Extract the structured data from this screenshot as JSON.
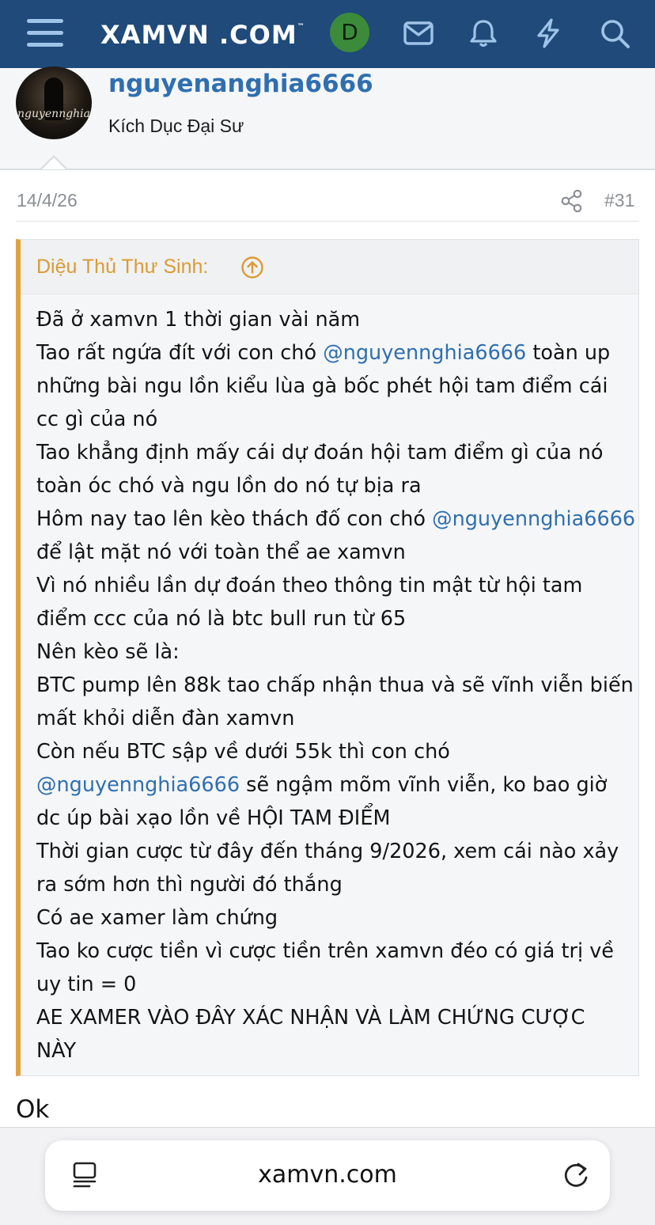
{
  "header": {
    "logo": "XAMVN",
    "logo_suffix": ".COM",
    "logo_tm": "™",
    "account_initial": "D",
    "icons": [
      "menu-icon",
      "envelope-icon",
      "bell-icon",
      "lightning-icon",
      "search-icon"
    ],
    "colors": {
      "bar": "#1f4a7a",
      "avatar": "#3c8b3a"
    }
  },
  "profile": {
    "username": "nguyenanghia6666",
    "avatar_text": "nguyennghia",
    "user_title": "Kích Dục Đại Sư"
  },
  "post": {
    "date": "14/4/26",
    "number": "#31",
    "quote": {
      "author": "Diệu Thủ Thư Sinh:",
      "lines": [
        "Đã ở xamvn 1 thời gian vài năm",
        "Tao rất ngứa đít với con chó ",
        "@nguyennghia6666",
        " toàn up",
        "những bài ngu lồn kiểu lùa gà bốc phét hội tam điểm cái",
        "cc gì của nó",
        "Tao khẳng định mấy cái dự đoán hội tam điểm gì của nó",
        "toàn óc chó và ngu lồn do nó tự bịa ra",
        "Hôm nay tao lên kèo thách đố con chó ",
        "@nguyennghia6666",
        "để lật mặt nó với toàn thể ae xamvn",
        "Vì nó nhiều lần dự đoán theo thông tin mật từ hội tam",
        "điểm ccc của nó là btc bull run từ 65",
        "Nên kèo sẽ là:",
        "BTC pump lên 88k tao chấp nhận thua và sẽ vĩnh viễn biến",
        "mất khỏi diễn đàn xamvn",
        "Còn nếu BTC sập về dưới 55k thì con chó",
        "@nguyennghia6666",
        " sẽ ngậm mõm vĩnh viễn, ko bao giờ",
        "dc úp bài xạo lồn về HỘI TAM ĐIỂM",
        "Thời gian cược từ đây đến tháng 9/2026, xem cái nào xảy",
        "ra sớm hơn thì người đó thắng",
        "Có ae xamer làm chứng",
        "Tao ko cược tiền vì cược tiền trên xamvn đéo có giá trị về",
        "uy tin = 0",
        "AE XAMER VÀO ĐÂY XÁC NHẬN VÀ LÀM CHỨNG CƯỢC",
        "NÀY"
      ]
    },
    "reply_text": "Ok"
  },
  "browser": {
    "url": "xamvn.com",
    "icons": [
      "reader-icon",
      "reload-icon"
    ]
  }
}
